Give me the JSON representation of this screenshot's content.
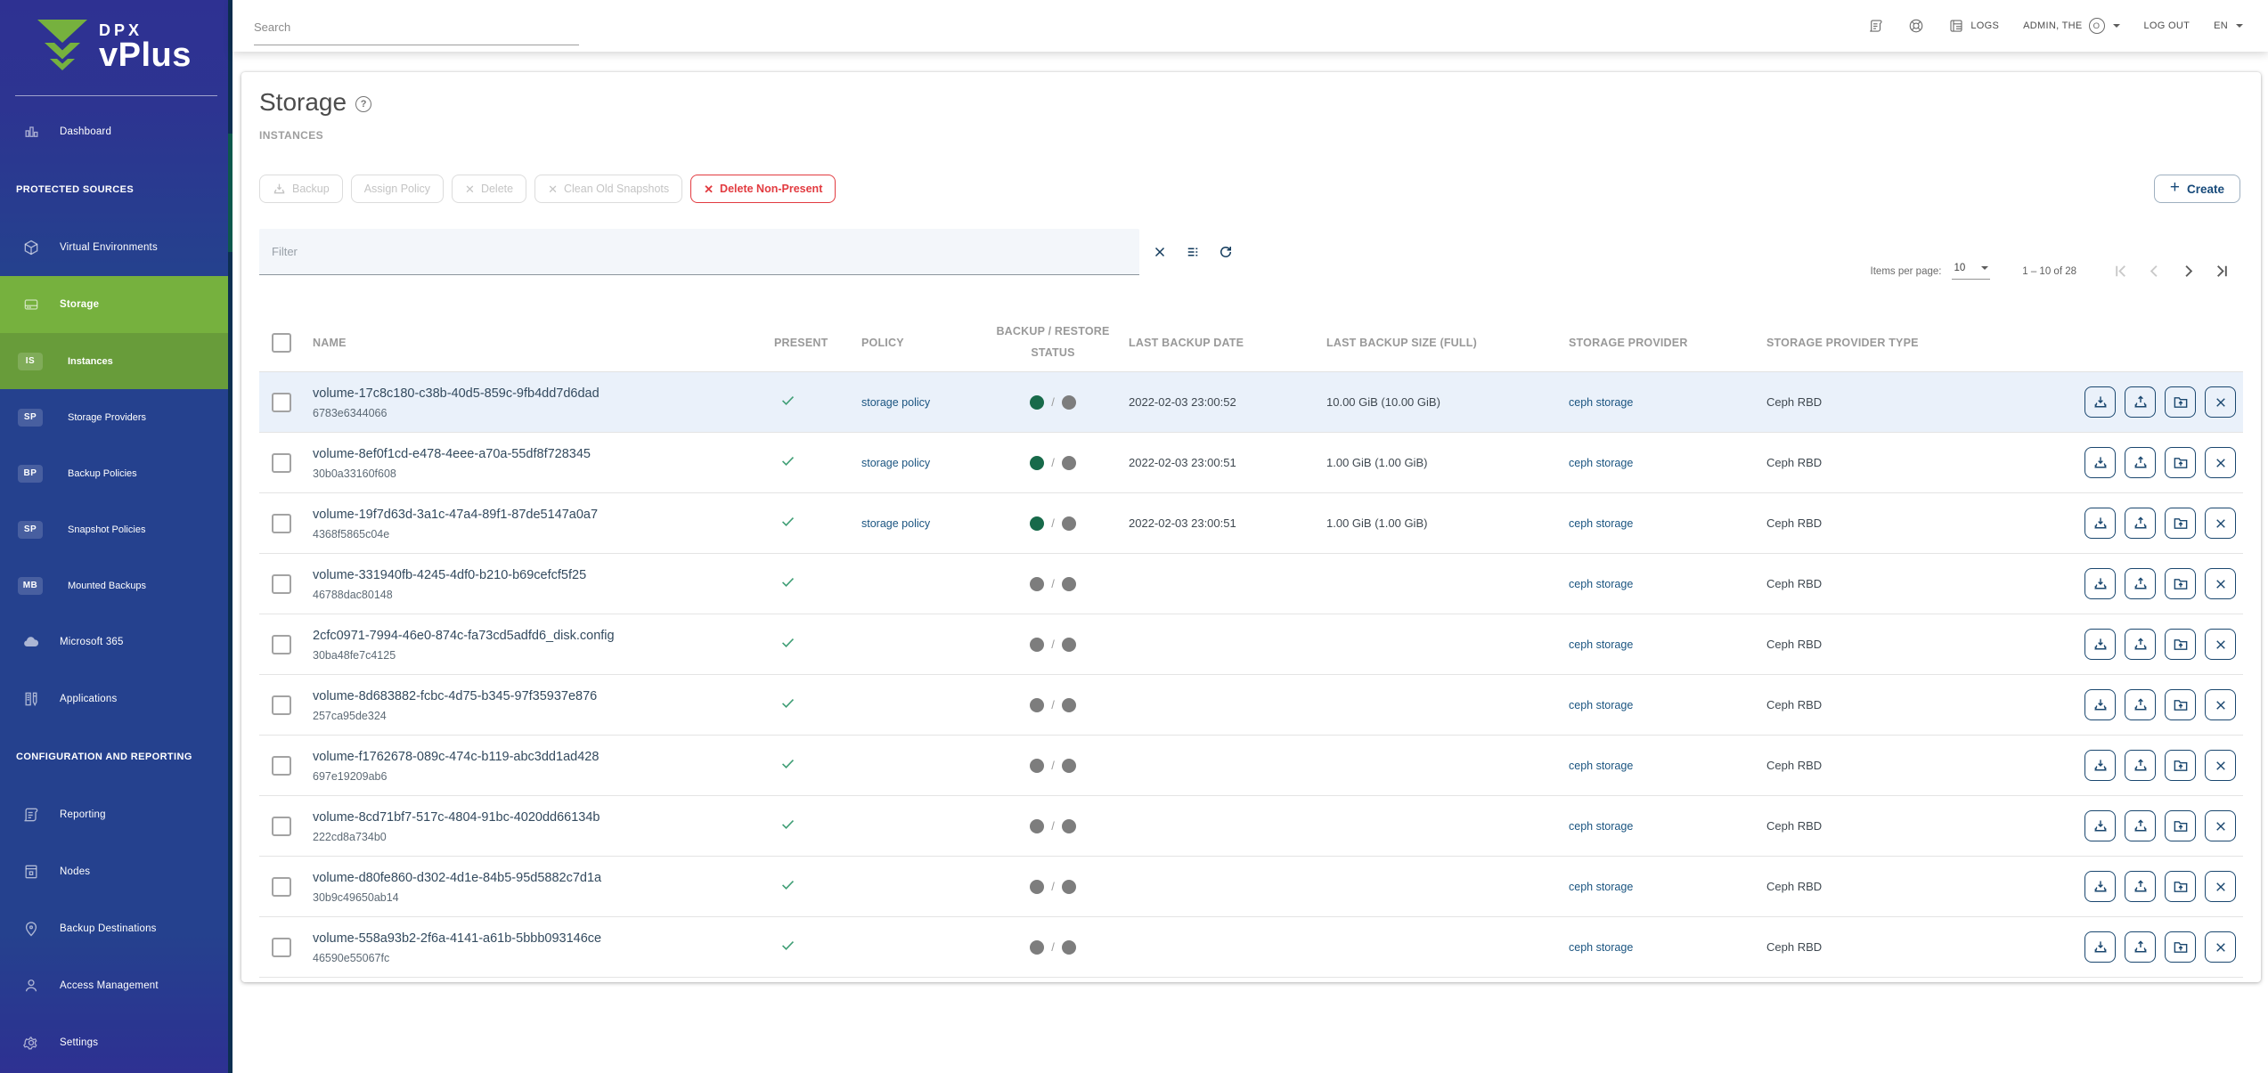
{
  "brand": {
    "line1": "DPX",
    "line2": "vPlus"
  },
  "topbar": {
    "search_placeholder": "Search",
    "logs_label": "LOGS",
    "user_label": "ADMIN, THE",
    "logout_label": "LOG OUT",
    "language_label": "EN"
  },
  "sidebar": {
    "items": [
      {
        "type": "item",
        "icon": "dashboard",
        "label": "Dashboard"
      },
      {
        "type": "section",
        "label": "PROTECTED SOURCES"
      },
      {
        "type": "item",
        "icon": "cube",
        "label": "Virtual Environments"
      },
      {
        "type": "item",
        "icon": "drive",
        "label": "Storage",
        "active": true
      },
      {
        "type": "sub",
        "badge": "IS",
        "label": "Instances",
        "active": true
      },
      {
        "type": "sub",
        "badge": "SP",
        "label": "Storage Providers"
      },
      {
        "type": "sub",
        "badge": "BP",
        "label": "Backup Policies"
      },
      {
        "type": "sub",
        "badge": "SP",
        "label": "Snapshot Policies"
      },
      {
        "type": "sub",
        "badge": "MB",
        "label": "Mounted Backups"
      },
      {
        "type": "item",
        "icon": "cloud",
        "label": "Microsoft 365"
      },
      {
        "type": "item",
        "icon": "apps",
        "label": "Applications"
      },
      {
        "type": "section",
        "label": "CONFIGURATION AND REPORTING"
      },
      {
        "type": "item",
        "icon": "scroll",
        "label": "Reporting"
      },
      {
        "type": "item",
        "icon": "server",
        "label": "Nodes"
      },
      {
        "type": "item",
        "icon": "pin",
        "label": "Backup Destinations"
      },
      {
        "type": "item",
        "icon": "person",
        "label": "Access Management"
      },
      {
        "type": "item",
        "icon": "gear",
        "label": "Settings"
      }
    ]
  },
  "page": {
    "title": "Storage",
    "subtitle": "INSTANCES"
  },
  "toolbar": {
    "backup_label": "Backup",
    "assign_policy_label": "Assign Policy",
    "delete_label": "Delete",
    "clean_label": "Clean Old Snapshots",
    "delete_non_present_label": "Delete Non-Present",
    "create_label": "Create"
  },
  "filter": {
    "placeholder": "Filter"
  },
  "pagination": {
    "items_per_page_label": "Items per page:",
    "page_size": "10",
    "range_label": "1 – 10 of 28"
  },
  "table": {
    "columns": [
      "NAME",
      "PRESENT",
      "POLICY",
      "BACKUP / RESTORE STATUS",
      "LAST BACKUP DATE",
      "LAST BACKUP SIZE (FULL)",
      "STORAGE PROVIDER",
      "STORAGE PROVIDER TYPE"
    ],
    "rows": [
      {
        "name": "volume-17c8c180-c38b-40d5-859c-9fb4dd7d6dad",
        "id": "6783e6344066",
        "present": true,
        "policy": "storage policy",
        "backup_status": "ok",
        "restore_status": "none",
        "last_backup_date": "2022-02-03 23:00:52",
        "last_backup_size": "10.00 GiB (10.00 GiB)",
        "provider": "ceph storage",
        "provider_type": "Ceph RBD",
        "highlighted": true
      },
      {
        "name": "volume-8ef0f1cd-e478-4eee-a70a-55df8f728345",
        "id": "30b0a33160f608",
        "present": true,
        "policy": "storage policy",
        "backup_status": "ok",
        "restore_status": "none",
        "last_backup_date": "2022-02-03 23:00:51",
        "last_backup_size": "1.00 GiB (1.00 GiB)",
        "provider": "ceph storage",
        "provider_type": "Ceph RBD"
      },
      {
        "name": "volume-19f7d63d-3a1c-47a4-89f1-87de5147a0a7",
        "id": "4368f5865c04e",
        "present": true,
        "policy": "storage policy",
        "backup_status": "ok",
        "restore_status": "none",
        "last_backup_date": "2022-02-03 23:00:51",
        "last_backup_size": "1.00 GiB (1.00 GiB)",
        "provider": "ceph storage",
        "provider_type": "Ceph RBD"
      },
      {
        "name": "volume-331940fb-4245-4df0-b210-b69cefcf5f25",
        "id": "46788dac80148",
        "present": true,
        "policy": "",
        "backup_status": "none",
        "restore_status": "none",
        "last_backup_date": "",
        "last_backup_size": "",
        "provider": "ceph storage",
        "provider_type": "Ceph RBD"
      },
      {
        "name": "2cfc0971-7994-46e0-874c-fa73cd5adfd6_disk.config",
        "id": "30ba48fe7c4125",
        "present": true,
        "policy": "",
        "backup_status": "none",
        "restore_status": "none",
        "last_backup_date": "",
        "last_backup_size": "",
        "provider": "ceph storage",
        "provider_type": "Ceph RBD"
      },
      {
        "name": "volume-8d683882-fcbc-4d75-b345-97f35937e876",
        "id": "257ca95de324",
        "present": true,
        "policy": "",
        "backup_status": "none",
        "restore_status": "none",
        "last_backup_date": "",
        "last_backup_size": "",
        "provider": "ceph storage",
        "provider_type": "Ceph RBD"
      },
      {
        "name": "volume-f1762678-089c-474c-b119-abc3dd1ad428",
        "id": "697e19209ab6",
        "present": true,
        "policy": "",
        "backup_status": "none",
        "restore_status": "none",
        "last_backup_date": "",
        "last_backup_size": "",
        "provider": "ceph storage",
        "provider_type": "Ceph RBD"
      },
      {
        "name": "volume-8cd71bf7-517c-4804-91bc-4020dd66134b",
        "id": "222cd8a734b0",
        "present": true,
        "policy": "",
        "backup_status": "none",
        "restore_status": "none",
        "last_backup_date": "",
        "last_backup_size": "",
        "provider": "ceph storage",
        "provider_type": "Ceph RBD"
      },
      {
        "name": "volume-d80fe860-d302-4d1e-84b5-95d5882c7d1a",
        "id": "30b9c49650ab14",
        "present": true,
        "policy": "",
        "backup_status": "none",
        "restore_status": "none",
        "last_backup_date": "",
        "last_backup_size": "",
        "provider": "ceph storage",
        "provider_type": "Ceph RBD"
      },
      {
        "name": "volume-558a93b2-2f6a-4141-a61b-5bbb093146ce",
        "id": "46590e55067fc",
        "present": true,
        "policy": "",
        "backup_status": "none",
        "restore_status": "none",
        "last_backup_date": "",
        "last_backup_size": "",
        "provider": "ceph storage",
        "provider_type": "Ceph RBD"
      }
    ]
  }
}
